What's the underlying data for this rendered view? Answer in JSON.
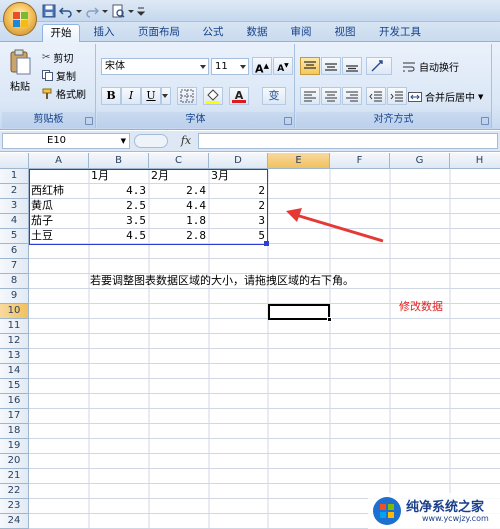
{
  "tabs": [
    "开始",
    "插入",
    "页面布局",
    "公式",
    "数据",
    "审阅",
    "视图",
    "开发工具"
  ],
  "clipboard": {
    "cut": "剪切",
    "copy": "复制",
    "paste": "粘贴",
    "format_painter": "格式刷",
    "label": "剪贴板"
  },
  "font": {
    "name": "宋体",
    "size": "11",
    "grow": "A",
    "shrink": "A",
    "bold": "B",
    "italic": "I",
    "underline": "U",
    "label": "字体",
    "color_letter": "A",
    "wen": "变"
  },
  "alignment": {
    "wrap_text": "自动换行",
    "merge_center": "合并后居中",
    "label": "对齐方式"
  },
  "formula_bar": {
    "name_box": "E10",
    "fx": "fx"
  },
  "columns": [
    "A",
    "B",
    "C",
    "D",
    "E",
    "F",
    "G",
    "H"
  ],
  "rows": [
    "1",
    "2",
    "3",
    "4",
    "5",
    "6",
    "7",
    "8",
    "9",
    "10",
    "11",
    "12",
    "13",
    "14",
    "15",
    "16",
    "17",
    "18",
    "19",
    "20",
    "21",
    "22",
    "23",
    "24"
  ],
  "sheet": {
    "headers": [
      "1月",
      "2月",
      "3月"
    ],
    "data": [
      {
        "name": "西红柿",
        "v1": "4.3",
        "v2": "2.4",
        "v3": "2"
      },
      {
        "name": "黄瓜",
        "v1": "2.5",
        "v2": "4.4",
        "v3": "2"
      },
      {
        "name": "茄子",
        "v1": "3.5",
        "v2": "1.8",
        "v3": "3"
      },
      {
        "name": "土豆",
        "v1": "4.5",
        "v2": "2.8",
        "v3": "5"
      }
    ],
    "note": "若要调整图表数据区域的大小，请拖拽区域的右下角。",
    "annotation": "修改数据"
  },
  "watermark": {
    "brand": "纯净系统之家",
    "url": "www.ycwjzy.com"
  },
  "colors": {
    "accent": "#2b579a",
    "annotation": "#e02020",
    "arrow": "#e53935",
    "range_border": "#2f3fd3"
  }
}
